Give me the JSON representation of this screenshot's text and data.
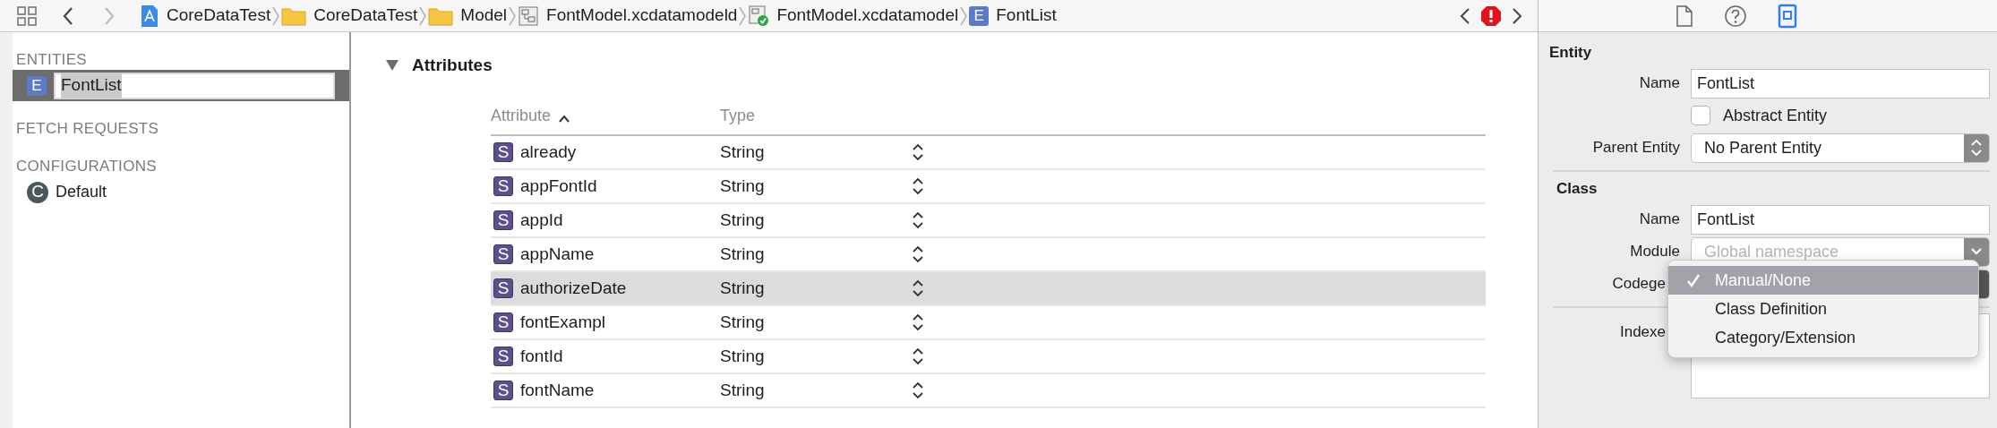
{
  "toolbar": {
    "breadcrumbs": [
      {
        "kind": "project",
        "label": "CoreDataTest"
      },
      {
        "kind": "folder",
        "label": "CoreDataTest"
      },
      {
        "kind": "folder",
        "label": "Model"
      },
      {
        "kind": "model_bundle",
        "label": "FontModel.xcdatamodeld"
      },
      {
        "kind": "model_version",
        "label": "FontModel.xcdatamodel"
      },
      {
        "kind": "entity",
        "label": "FontList",
        "badge": "E"
      }
    ]
  },
  "inspector_tabs": [
    {
      "kind": "file",
      "selected": false
    },
    {
      "kind": "help",
      "selected": false
    },
    {
      "kind": "data_model",
      "selected": true
    }
  ],
  "sidebar": {
    "sections": [
      {
        "title": "ENTITIES",
        "items": [
          {
            "kind": "entity",
            "badge": "E",
            "label": "FontList",
            "selected": true,
            "editing": true
          }
        ]
      },
      {
        "title": "FETCH REQUESTS"
      },
      {
        "title": "CONFIGURATIONS",
        "items": [
          {
            "kind": "configuration",
            "badge": "C",
            "label": "Default",
            "selected": false,
            "editing": false
          }
        ]
      }
    ]
  },
  "attributes": {
    "title": "Attributes",
    "expanded": true,
    "columns": [
      {
        "label": "Attribute",
        "sorted_ascending": true
      },
      {
        "label": "Type"
      }
    ],
    "rows": [
      {
        "badge": "S",
        "name": "already",
        "type": "String",
        "selected": false
      },
      {
        "badge": "S",
        "name": "appFontId",
        "type": "String",
        "selected": false
      },
      {
        "badge": "S",
        "name": "appId",
        "type": "String",
        "selected": false
      },
      {
        "badge": "S",
        "name": "appName",
        "type": "String",
        "selected": false
      },
      {
        "badge": "S",
        "name": "authorizeDate",
        "type": "String",
        "selected": true
      },
      {
        "badge": "S",
        "name": "fontExampl",
        "type": "String",
        "selected": false
      },
      {
        "badge": "S",
        "name": "fontId",
        "type": "String",
        "selected": false
      },
      {
        "badge": "S",
        "name": "fontName",
        "type": "String",
        "selected": false
      }
    ]
  },
  "inspector": {
    "entity": {
      "title": "Entity",
      "name_label": "Name",
      "name_value": "FontList",
      "abstract": {
        "label": "Abstract Entity",
        "checked": false
      },
      "parent": {
        "label": "Parent Entity",
        "value": "No Parent Entity"
      }
    },
    "class": {
      "title": "Class",
      "name_label": "Name",
      "name_value": "FontList",
      "module": {
        "label": "Module",
        "placeholder": "Global namespace"
      },
      "codegen": {
        "label": "Codege"
      },
      "indexes": {
        "label": "Indexe"
      }
    },
    "codegen_menu": [
      {
        "label": "Manual/None",
        "selected": true
      },
      {
        "label": "Class Definition",
        "selected": false
      },
      {
        "label": "Category/Extension",
        "selected": false
      }
    ]
  }
}
